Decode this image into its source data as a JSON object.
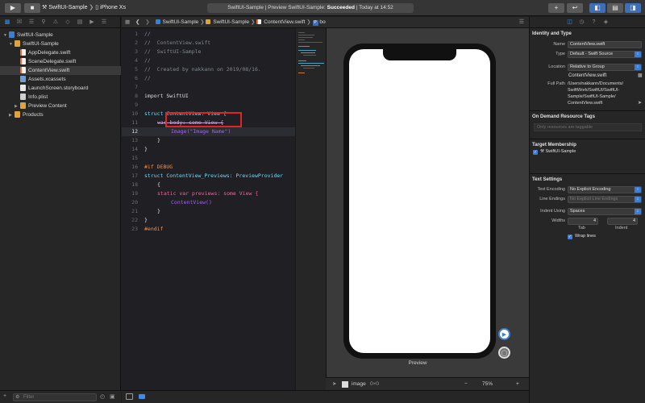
{
  "toolbar": {
    "scheme_project": "SwiftUI-Sample",
    "scheme_device": "iPhone Xs",
    "status_project": "SwiftUI-Sample",
    "status_mid": "Preview SwiftUI-Sample:",
    "status_result": "Succeeded",
    "status_time": "Today at 14:52",
    "add_label": "+",
    "back_label": "↩"
  },
  "navigator": {
    "filter_placeholder": "Filter",
    "items": [
      {
        "label": "SwiftUI-Sample"
      },
      {
        "label": "SwiftUI-Sample"
      },
      {
        "label": "AppDelegate.swift"
      },
      {
        "label": "SceneDelegate.swift"
      },
      {
        "label": "ContentView.swift"
      },
      {
        "label": "Assets.xcassets"
      },
      {
        "label": "LaunchScreen.storyboard"
      },
      {
        "label": "Info.plist"
      },
      {
        "label": "Preview Content"
      },
      {
        "label": "Products"
      }
    ]
  },
  "jumpbar": {
    "project": "SwiftUI-Sample",
    "folder": "SwiftUI-Sample",
    "file": "ContentView.swift",
    "symbol_badge": "P",
    "symbol": "body"
  },
  "editor": {
    "lines": [
      {
        "n": "1",
        "text": "//"
      },
      {
        "n": "2",
        "text": "//  ContentView.swift"
      },
      {
        "n": "3",
        "text": "//  SwiftUI-Sample"
      },
      {
        "n": "4",
        "text": "//"
      },
      {
        "n": "5",
        "text": "//  Created by nakkann on 2019/08/16."
      },
      {
        "n": "6",
        "text": "//"
      },
      {
        "n": "7",
        "text": ""
      },
      {
        "n": "8",
        "text": "import SwiftUI"
      },
      {
        "n": "9",
        "text": ""
      },
      {
        "n": "10",
        "text": "struct ContentView: View {"
      },
      {
        "n": "11",
        "text": "var body: some View {"
      },
      {
        "n": "12",
        "text": "Image(\"Image Name\")"
      },
      {
        "n": "13",
        "text": "}"
      },
      {
        "n": "14",
        "text": "}"
      },
      {
        "n": "15",
        "text": ""
      },
      {
        "n": "16",
        "text": "#if DEBUG"
      },
      {
        "n": "17",
        "text": "struct ContentView_Previews: PreviewProvider"
      },
      {
        "n": "18",
        "text": "{"
      },
      {
        "n": "19",
        "text": "static var previews: some View {"
      },
      {
        "n": "20",
        "text": "ContentView()"
      },
      {
        "n": "21",
        "text": "}"
      },
      {
        "n": "22",
        "text": "}"
      },
      {
        "n": "23",
        "text": "#endif"
      }
    ]
  },
  "canvas": {
    "preview_label": "Preview",
    "footer_item": "image",
    "footer_size": "0×0",
    "zoom": "75%",
    "zoom_out": "−",
    "zoom_in": "+"
  },
  "inspector": {
    "identity": {
      "title": "Identity and Type",
      "name_label": "Name",
      "name_value": "ContentView.swift",
      "type_label": "Type",
      "type_value": "Default - Swift Source",
      "location_label": "Location",
      "location_value": "Relative to Group",
      "location_file": "ContentView.swift",
      "fullpath_label": "Full Path",
      "fullpath_value": "/Users/nakkann/Documents/\nSwiftWork/SwiftUI/SwiftUI-\nSample/SwiftUI-Sample/\nContentView.swift"
    },
    "on_demand": {
      "title": "On Demand Resource Tags",
      "placeholder": "Only resources are taggable"
    },
    "target": {
      "title": "Target Membership",
      "item": "SwiftUI-Sample"
    },
    "text_settings": {
      "title": "Text Settings",
      "encoding_label": "Text Encoding",
      "encoding_value": "No Explicit Encoding",
      "endings_label": "Line Endings",
      "endings_value": "No Explicit Line Endings",
      "indent_label": "Indent Using",
      "indent_value": "Spaces",
      "widths_label": "Widths",
      "tab_value": "4",
      "indent_width_value": "4",
      "tab_label": "Tab",
      "indent_sub_label": "Indent",
      "wrap_label": "Wrap lines"
    }
  }
}
